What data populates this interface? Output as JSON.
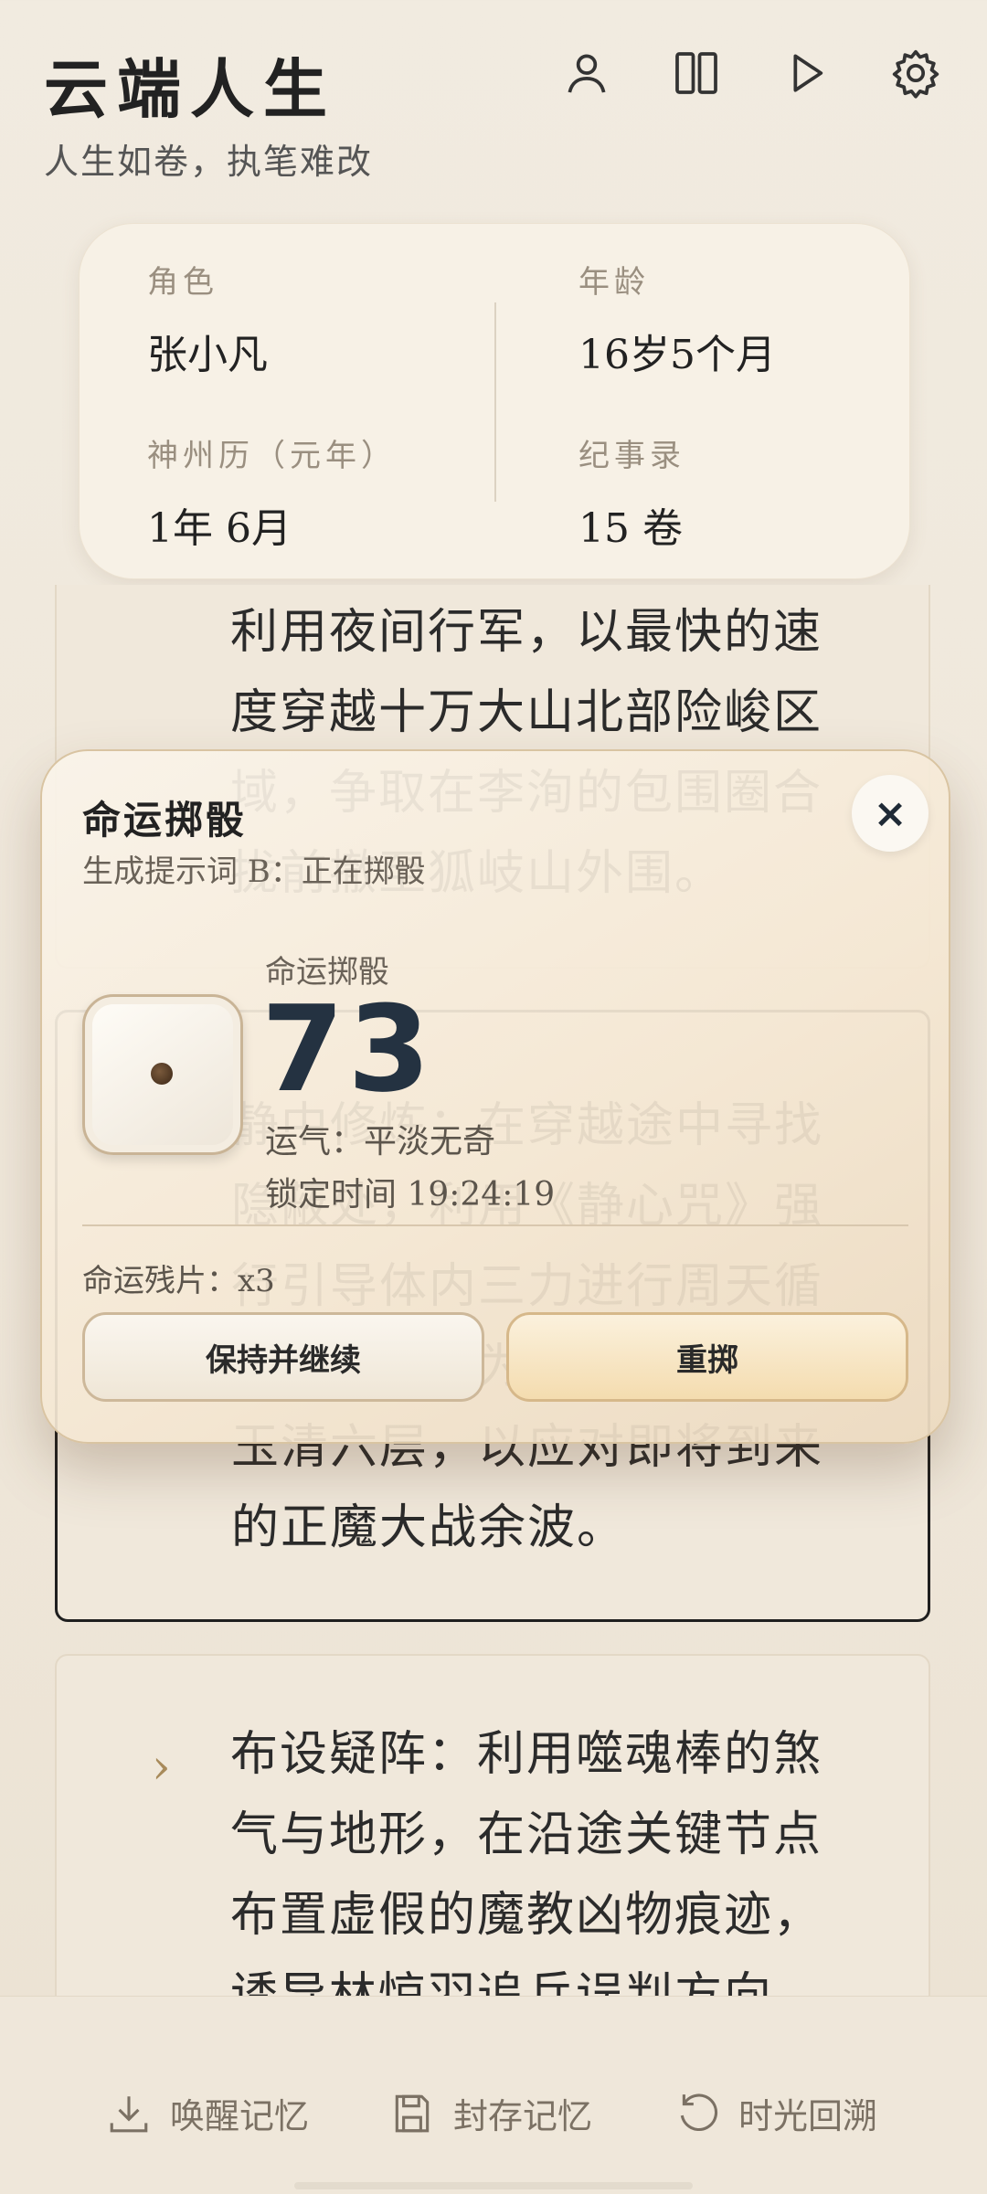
{
  "app": {
    "title": "云端人生",
    "subtitle": "人生如卷，执笔难改"
  },
  "header_icons": [
    "person-icon",
    "book-icon",
    "play-icon",
    "gear-icon"
  ],
  "info": {
    "role_label": "角色",
    "role_value": "张小凡",
    "age_label": "年龄",
    "age_value": "16岁5个月",
    "calendar_label": "神州历（元年）",
    "calendar_value": "1年 6月",
    "chronicle_label": "纪事录",
    "chronicle_value": "15 卷"
  },
  "story": {
    "card1_text": "利用夜间行军，以最快的速度穿越十万大山北部险峻区域，争取在李洵的包围圈合拢前撤至狐岐山外围。",
    "card2_text": "静中修炼：在穿越途中寻找隐蔽处，利用《静心咒》强行引导体内三力进行周天循环，稳固修为，力图突破至玉清六层，以应对即将到来的正魔大战余波。",
    "card3_text": "布设疑阵：利用噬魂棒的煞气与地形，在沿途关键节点布置虚假的魔教凶物痕迹，诱导林惊羽追兵误判方向。"
  },
  "dice_modal": {
    "title": "命运掷骰",
    "subtitle": "生成提示词 B：正在掷骰",
    "roll_label": "命运掷骰",
    "roll_value": "73",
    "luck": "运气：平淡无奇",
    "lock_time": "锁定时间 19:24:19",
    "shards": "命运残片：x3",
    "keep_button": "保持并继续",
    "reroll_button": "重掷",
    "close_symbol": "×"
  },
  "bottom_bar": {
    "wake_memory": "唤醒记忆",
    "save_memory": "封存记忆",
    "time_rewind": "时光回溯"
  }
}
